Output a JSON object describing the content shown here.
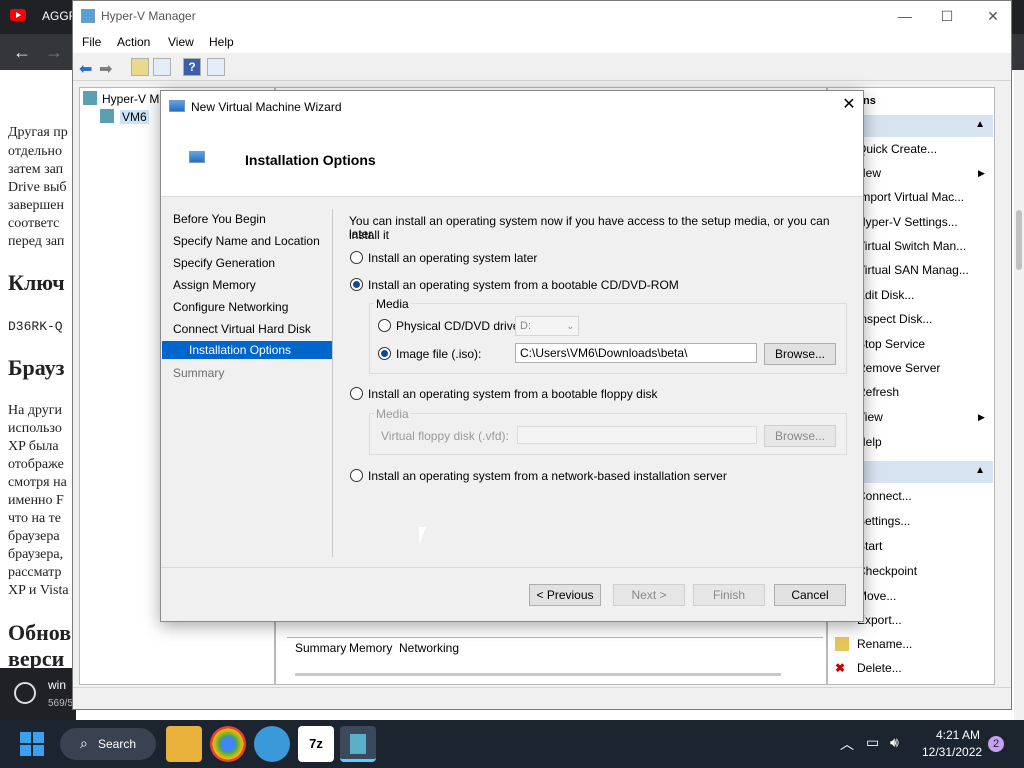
{
  "browser": {
    "tab_label": "AGGR",
    "nav_back": "←",
    "nav_forward": "→",
    "article_lines": [
      "Другая пр",
      "отдельно",
      "затем зап",
      "Drive выб",
      "завершен",
      "соответс",
      "перед зап"
    ],
    "heading_1": "Ключ",
    "key_text": "D36RK-Q",
    "heading_2": "Брауз",
    "article_lines_2": [
      "На други",
      "использо",
      "XP была",
      "отображе",
      "смотря на",
      "именно F",
      "что на те",
      "браузера",
      "браузера,",
      "рассматр",
      "XP и Vista"
    ],
    "heading_3": "Обнов",
    "heading_3b": "верси",
    "download_name": "win",
    "download_size": "569/5"
  },
  "hyperv": {
    "title": "Hyper-V Manager",
    "menu": [
      "File",
      "Action",
      "View",
      "Help"
    ],
    "tree_root": "Hyper-V M",
    "tree_child": "VM6",
    "actions_header_partial": "ns",
    "actions": [
      {
        "label": "Quick Create...",
        "arrow": false
      },
      {
        "label": "New",
        "arrow": true
      },
      {
        "label": "Import Virtual Mac...",
        "arrow": false
      },
      {
        "label": "Hyper-V Settings...",
        "arrow": false
      },
      {
        "label": "Virtual Switch Man...",
        "arrow": false
      },
      {
        "label": "Virtual SAN Manag...",
        "arrow": false
      },
      {
        "label": "Edit Disk...",
        "arrow": false
      },
      {
        "label": "Inspect Disk...",
        "arrow": false
      },
      {
        "label": "Stop Service",
        "arrow": false
      },
      {
        "label": "Remove Server",
        "arrow": false
      },
      {
        "label": "Refresh",
        "arrow": false
      },
      {
        "label": "View",
        "arrow": true
      },
      {
        "label": "Help",
        "arrow": false
      }
    ],
    "vm_actions": [
      "Connect...",
      "Settings...",
      "Start",
      "Checkpoint",
      "Move...",
      "Export...",
      "Rename...",
      "Delete..."
    ],
    "bottom_tabs": [
      "Summary",
      "Memory",
      "Networking"
    ]
  },
  "wizard": {
    "title": "New Virtual Machine Wizard",
    "heading": "Installation Options",
    "steps": [
      "Before You Begin",
      "Specify Name and Location",
      "Specify Generation",
      "Assign Memory",
      "Configure Networking",
      "Connect Virtual Hard Disk",
      "Installation Options",
      "Summary"
    ],
    "active_step": "Installation Options",
    "intro": "You can install an operating system now if you have access to the setup media, or you can install it later.",
    "intro_line1": "You can install an operating system now if you have access to the setup media, or you can install it",
    "intro_line2": "later.",
    "opt_later": "Install an operating system later",
    "opt_cd": "Install an operating system from a bootable CD/DVD-ROM",
    "media_label": "Media",
    "physical_drive_label": "Physical CD/DVD drive:",
    "physical_drive_value": "D:",
    "image_file_label": "Image file (.iso):",
    "image_file_value": "C:\\Users\\VM6\\Downloads\\beta\\",
    "browse": "Browse...",
    "opt_floppy": "Install an operating system from a bootable floppy disk",
    "floppy_media_label": "Media",
    "floppy_label": "Virtual floppy disk (.vfd):",
    "floppy_value": "",
    "browse_disabled": "Browse...",
    "opt_network": "Install an operating system from a network-based installation server",
    "btn_previous": "< Previous",
    "btn_next": "Next >",
    "btn_finish": "Finish",
    "btn_cancel": "Cancel"
  },
  "taskbar": {
    "search_label": "Search",
    "time": "4:21 AM",
    "date": "12/31/2022",
    "notification_count": "2"
  }
}
